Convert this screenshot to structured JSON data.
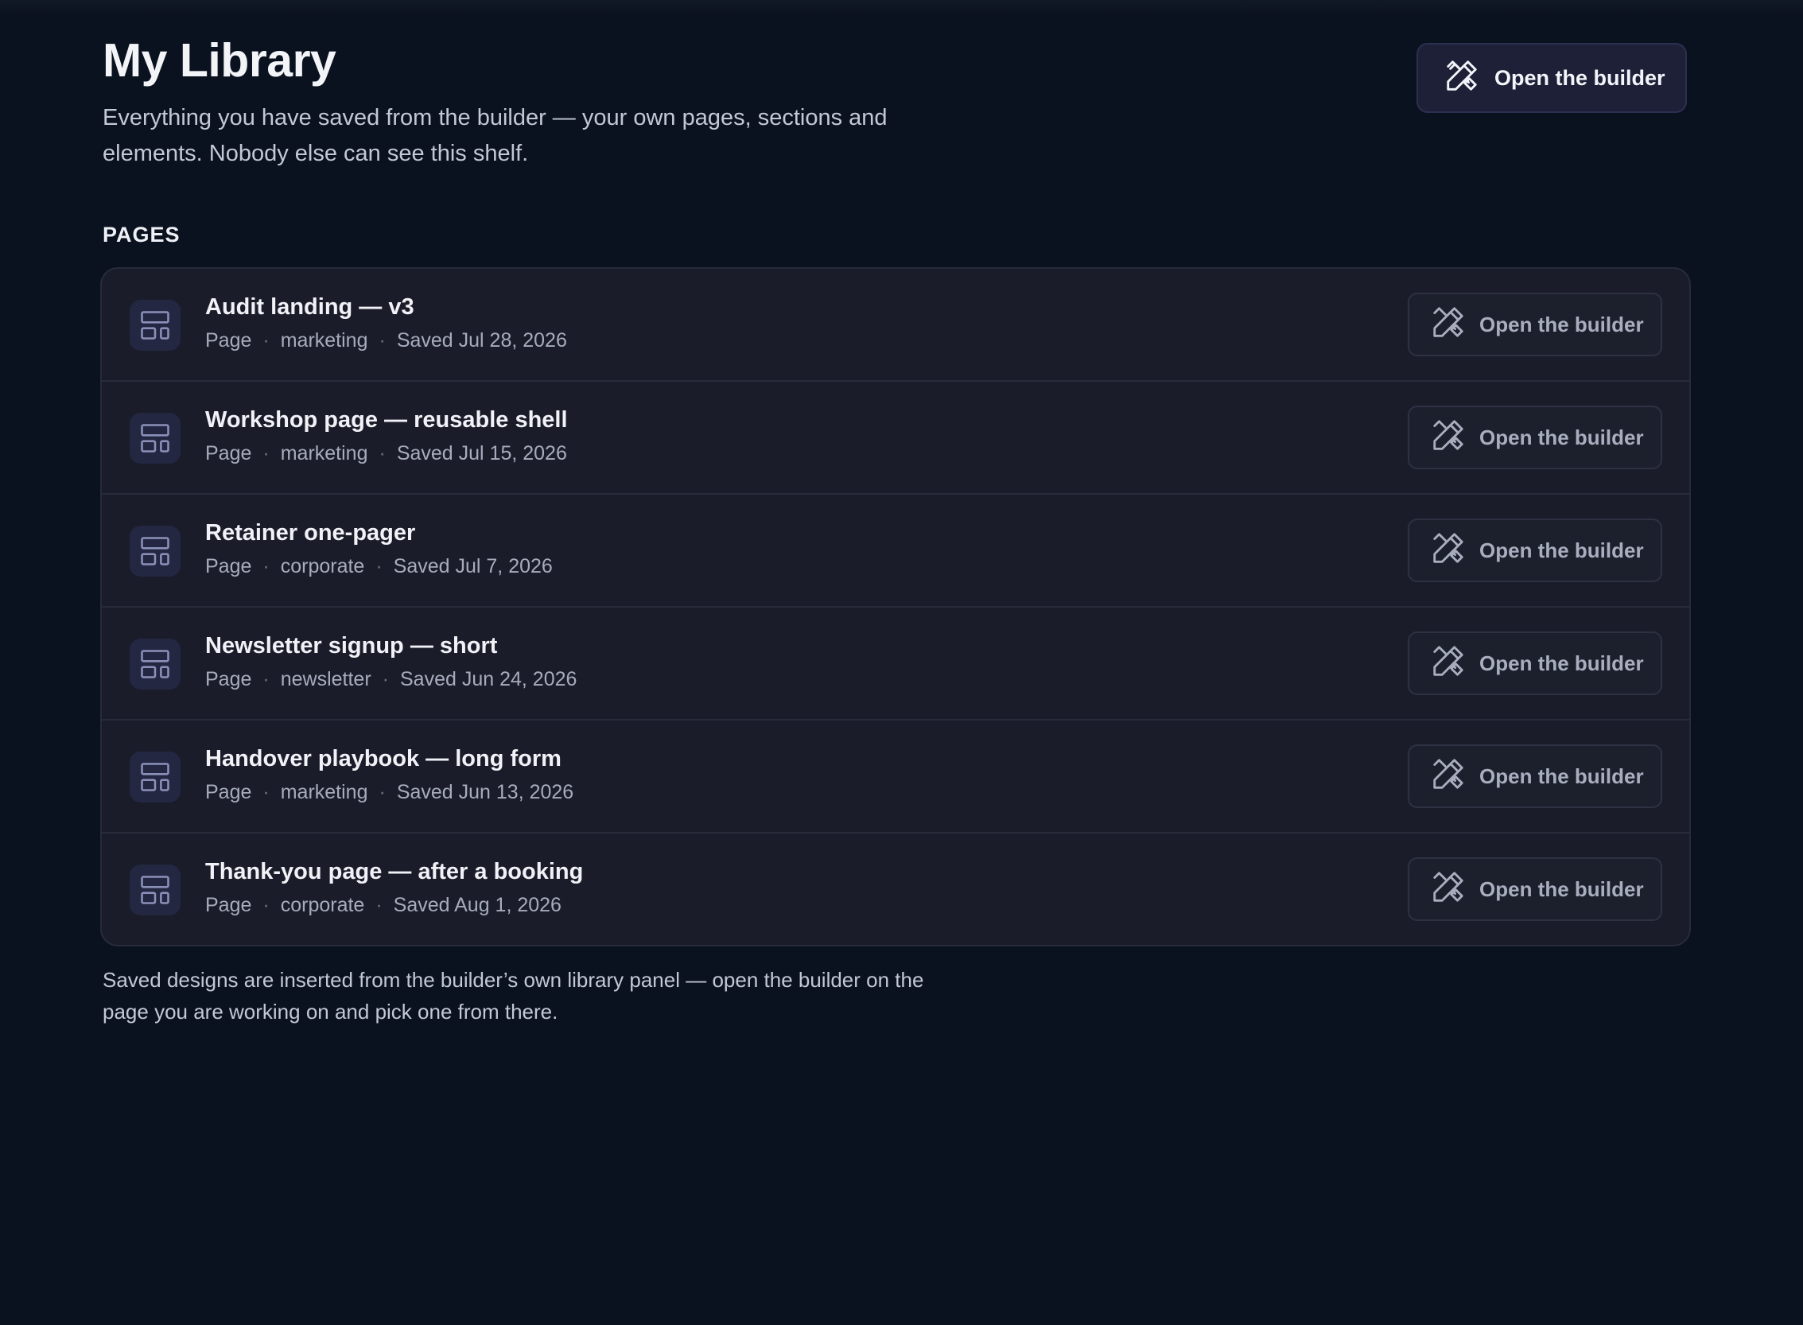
{
  "header": {
    "title": "My Library",
    "description": "Everything you have saved from the builder — your own pages, sections and elements. Nobody else can see this shelf.",
    "primary_button": {
      "label": "Open the builder",
      "icon": "pencil-ruler-icon"
    }
  },
  "section": {
    "label": "PAGES"
  },
  "items": [
    {
      "title": "Audit landing — v3",
      "type": "Page",
      "tag": "marketing",
      "saved": "Saved Jul 28, 2026",
      "button_label": "Open the builder",
      "icon": "layout-template-icon"
    },
    {
      "title": "Workshop page — reusable shell",
      "type": "Page",
      "tag": "marketing",
      "saved": "Saved Jul 15, 2026",
      "button_label": "Open the builder",
      "icon": "layout-template-icon"
    },
    {
      "title": "Retainer one-pager",
      "type": "Page",
      "tag": "corporate",
      "saved": "Saved Jul 7, 2026",
      "button_label": "Open the builder",
      "icon": "layout-template-icon"
    },
    {
      "title": "Newsletter signup — short",
      "type": "Page",
      "tag": "newsletter",
      "saved": "Saved Jun 24, 2026",
      "button_label": "Open the builder",
      "icon": "layout-template-icon"
    },
    {
      "title": "Handover playbook — long form",
      "type": "Page",
      "tag": "marketing",
      "saved": "Saved Jun 13, 2026",
      "button_label": "Open the builder",
      "icon": "layout-template-icon"
    },
    {
      "title": "Thank-you page — after a booking",
      "type": "Page",
      "tag": "corporate",
      "saved": "Saved Aug 1, 2026",
      "button_label": "Open the builder",
      "icon": "layout-template-icon"
    }
  ],
  "footer": {
    "note": "Saved designs are inserted from the builder’s own library panel — open the builder on the page you are working on and pick one from there."
  },
  "colors": {
    "background": "#0b121f",
    "card": "#1a1d29",
    "accent_button": "#1d2036",
    "icon_tile": "#232742",
    "icon_stroke": "#8b90b8"
  }
}
